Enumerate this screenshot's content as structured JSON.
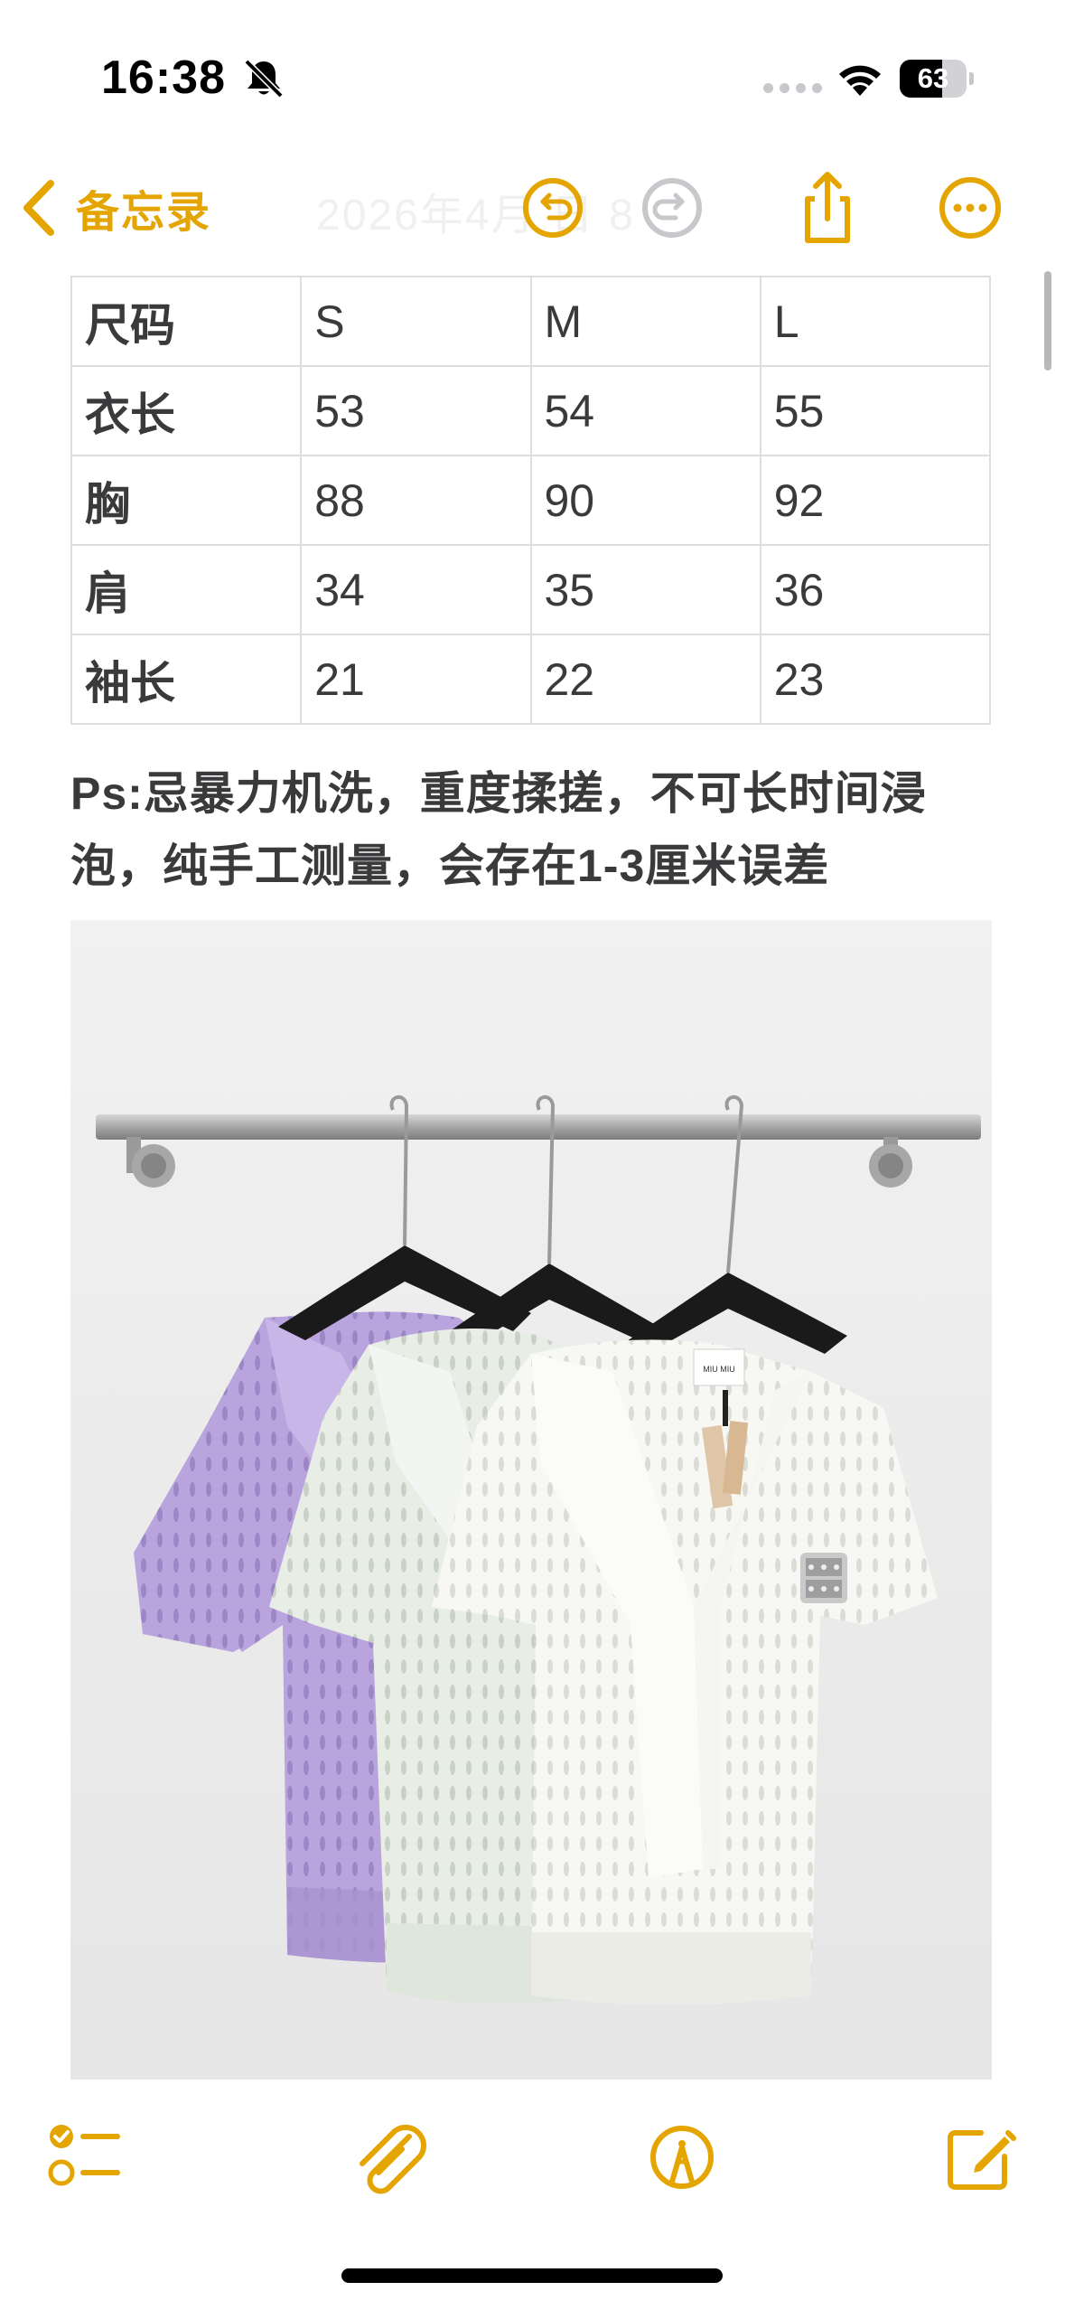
{
  "status_bar": {
    "time": "16:38",
    "battery_level": "63",
    "battery_fraction": 0.63,
    "icons": [
      "bell-slash-icon",
      "signal-icon",
      "wifi-icon",
      "battery-icon"
    ]
  },
  "nav": {
    "back_label": "备忘录",
    "title": "2026年4月 日  8",
    "icons": [
      "chevron-left-icon",
      "undo-icon",
      "redo-icon",
      "share-icon",
      "more-icon"
    ]
  },
  "colors": {
    "accent": "#E5A500",
    "text": "#3A3A3C",
    "disabled": "#C7C7CC"
  },
  "table": {
    "header": [
      "尺码",
      "S",
      "M",
      "L"
    ],
    "rows": [
      [
        "衣长",
        "53",
        "54",
        "55"
      ],
      [
        "胸",
        "88",
        "90",
        "92"
      ],
      [
        "肩",
        "34",
        "35",
        "36"
      ],
      [
        "袖长",
        "21",
        "22",
        "23"
      ]
    ]
  },
  "note": {
    "line1": "Ps:忌暴力机洗，重度揉搓，不可长时间浸",
    "line2": "泡，纯手工测量，会存在1-3厘米误差"
  },
  "photo": {
    "garment_colors": [
      "#B7A2DC",
      "#E9EEE7",
      "#F6F6F2"
    ],
    "tag_brand": "MIU MIU"
  },
  "toolbar": {
    "icons": [
      "checklist-icon",
      "paperclip-icon",
      "markup-pen-icon",
      "compose-icon"
    ]
  }
}
